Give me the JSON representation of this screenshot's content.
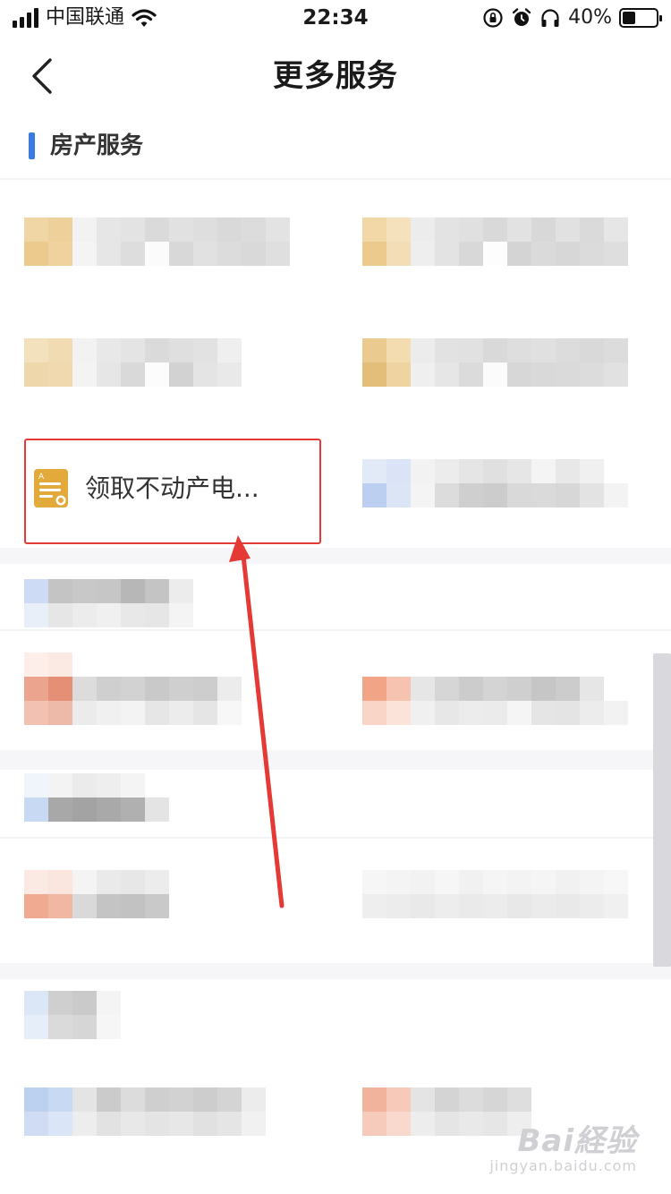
{
  "status_bar": {
    "carrier": "中国联通",
    "time": "22:34",
    "battery_percent": "40%",
    "battery_level": 0.4,
    "icons": [
      "signal-icon",
      "wifi-icon",
      "rotation-lock-icon",
      "alarm-icon",
      "headphones-icon",
      "battery-icon"
    ]
  },
  "nav": {
    "title": "更多服务",
    "back_icon": "chevron-left-icon"
  },
  "section": {
    "title": "房产服务",
    "accent_color": "#3a7be0"
  },
  "highlighted_service": {
    "label": "领取不动产电...",
    "icon": "certificate-document-icon",
    "icon_color": "#e2a93b",
    "highlight_color": "#e53935"
  },
  "annotation": {
    "arrow_color": "#e53935"
  },
  "watermark": {
    "logo": "Bai経验",
    "sub": "jingyan.baidu.com"
  }
}
